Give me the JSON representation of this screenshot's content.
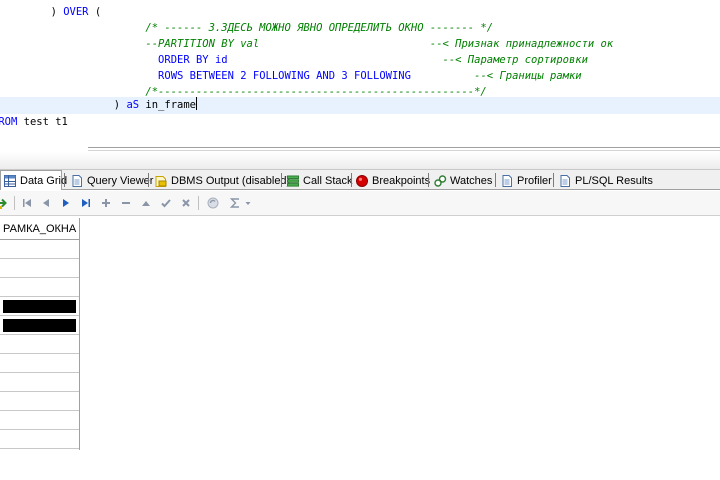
{
  "editor": {
    "lines": [
      {
        "t1": "        ) ",
        "kw1": "OVER",
        "t2": " ("
      },
      {
        "comment": "                       /* ------ 3.ЗДЕСЬ МОЖНО ЯВНО ОПРЕДЕЛИТЬ ОКНО ------- */"
      },
      {
        "code": "                       --PARTITION BY val",
        "comment": "                           --< Признак принадлежности ок"
      },
      {
        "indent": "                         ",
        "kw1": "ORDER BY",
        "t2": " id",
        "comment": "                                  --< Параметр сортировки"
      },
      {
        "indent": "                         ",
        "kw1": "ROWS BETWEEN",
        "n1": " 2 ",
        "kw2": "FOLLOWING AND",
        "n2": " 3 ",
        "kw3": "FOLLOWING",
        "comment": "          --< Границы рамки"
      },
      {
        "comment": "                       /*--------------------------------------------------*/"
      },
      {
        "t1": "                  ) ",
        "kw1": "aS",
        "t2": " in_frame"
      },
      {
        "kw1": "FROM",
        "t2": " test t1"
      }
    ]
  },
  "tabs": [
    {
      "label": "Data Grid",
      "icon": "grid-icon"
    },
    {
      "label": "Query Viewer",
      "icon": "document-icon"
    },
    {
      "label": "DBMS Output (disabled)",
      "icon": "output-icon"
    },
    {
      "label": "Call Stack",
      "icon": "stack-icon"
    },
    {
      "label": "Breakpoints",
      "icon": "breakpoint-icon"
    },
    {
      "label": "Watches",
      "icon": "watch-icon"
    },
    {
      "label": "Profiler",
      "icon": "document-icon"
    },
    {
      "label": "PL/SQL Results",
      "icon": "document-icon"
    }
  ],
  "toolbar": {
    "icons": [
      "export-icon",
      "first-record-icon",
      "prior-record-icon",
      "next-record-icon",
      "last-record-icon",
      "insert-record-icon",
      "delete-record-icon",
      "edit-record-icon",
      "post-edit-icon",
      "cancel-edit-icon",
      "refresh-icon",
      "sum-icon",
      "dropdown-arrow-icon"
    ]
  },
  "grid": {
    "column": "РАМКА_ОКНА",
    "rows": [
      "",
      "",
      "",
      "",
      "",
      "",
      "",
      "",
      "",
      "",
      ""
    ],
    "redacted_rows": [
      3,
      4
    ]
  },
  "colors": {
    "keyword": "#0000ff",
    "comment": "#008000",
    "current_line": "#e8f2fe",
    "breakpoint": "#d40000"
  }
}
